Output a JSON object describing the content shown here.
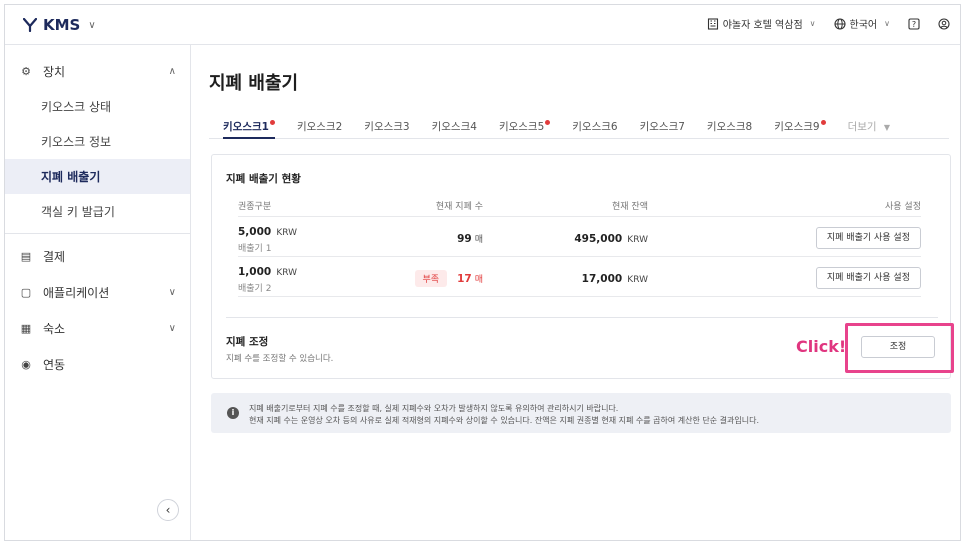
{
  "header": {
    "brand": "KMS",
    "property": "야놀자 호텔 역삼점",
    "language": "한국어"
  },
  "sidebar": {
    "groups": [
      {
        "label": "장치",
        "icon": "gear-icon",
        "expanded": true,
        "items": [
          "키오스크 상태",
          "키오스크 정보",
          "지폐 배출기",
          "객실 키 발급기"
        ],
        "active": "지폐 배출기"
      },
      {
        "label": "결제",
        "icon": "receipt-icon"
      },
      {
        "label": "애플리케이션",
        "icon": "tablet-icon"
      },
      {
        "label": "숙소",
        "icon": "building-icon"
      },
      {
        "label": "연동",
        "icon": "link-icon"
      }
    ]
  },
  "page": {
    "title": "지폐 배출기",
    "tabs": [
      {
        "label": "키오스크1",
        "dot": true,
        "active": true
      },
      {
        "label": "키오스크2",
        "dot": false
      },
      {
        "label": "키오스크3",
        "dot": false
      },
      {
        "label": "키오스크4",
        "dot": false
      },
      {
        "label": "키오스크5",
        "dot": true
      },
      {
        "label": "키오스크6",
        "dot": false
      },
      {
        "label": "키오스크7",
        "dot": false
      },
      {
        "label": "키오스크8",
        "dot": false
      },
      {
        "label": "키오스크9",
        "dot": true
      }
    ],
    "more_tab": "더보기",
    "status": {
      "title": "지폐 배출기 현황",
      "columns": [
        "권종구분",
        "현재 지폐 수",
        "현재 잔액",
        "사용 설정"
      ],
      "rows": [
        {
          "denom": "5,000",
          "unit": "KRW",
          "dispenser": "배출기 1",
          "count": "99",
          "count_unit": "매",
          "low": false,
          "balance": "495,000",
          "balance_unit": "KRW",
          "button": "지폐 배출기 사용 설정"
        },
        {
          "denom": "1,000",
          "unit": "KRW",
          "dispenser": "배출기 2",
          "count": "17",
          "count_unit": "매",
          "low": true,
          "low_label": "부족",
          "balance": "17,000",
          "balance_unit": "KRW",
          "button": "지폐 배출기 사용 설정"
        }
      ]
    },
    "adjust": {
      "title": "지폐 조정",
      "description": "지폐 수를 조정할 수 있습니다.",
      "button": "조정",
      "annotation": "Click!"
    },
    "notice": {
      "line1": "지폐 배출기로부터 지폐 수를 조정할 때, 실제 지폐수와 오차가 발생하지 않도록 유의하여 관리하시기 바랍니다.",
      "line2": "현재 지폐 수는 운영상 오차 등의 사유로 실제 적재형의 지폐수와 상이할 수 있습니다. 잔액은 지폐 권종별 현재 지폐 수를 곱하여 계산한 단순 결과입니다."
    }
  },
  "colors": {
    "brand": "#1d2a5c",
    "alert": "#e13c3c",
    "annotation": "#e8438c"
  }
}
